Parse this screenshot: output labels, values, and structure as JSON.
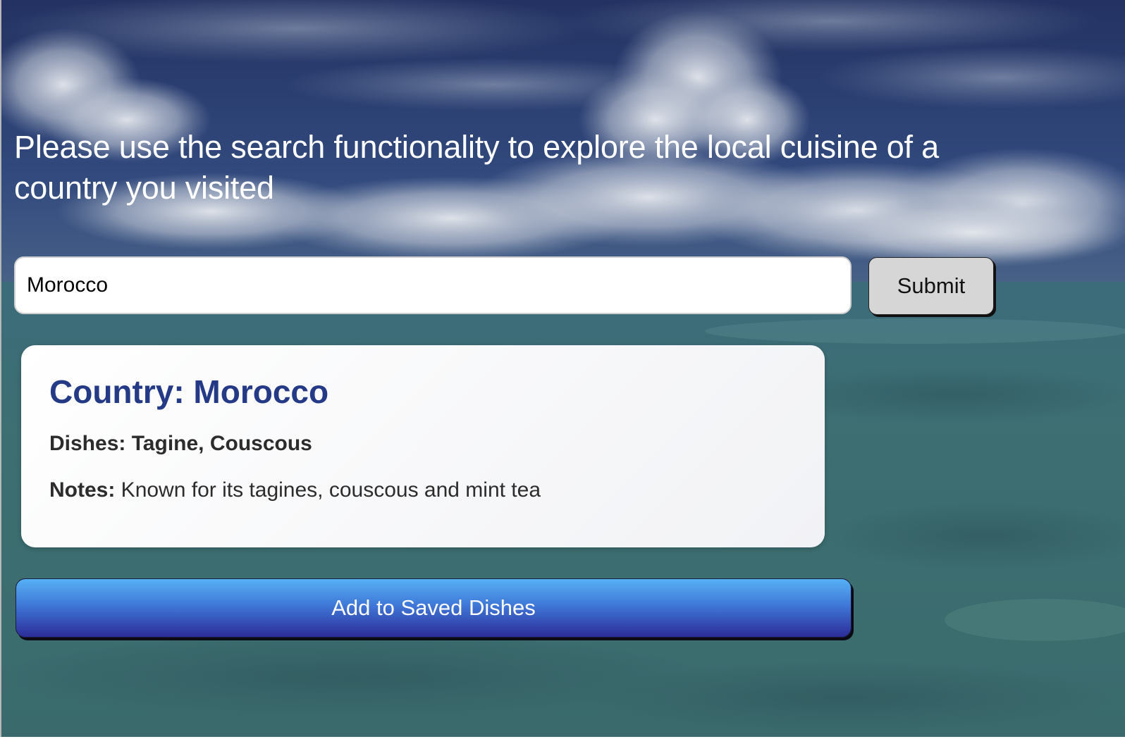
{
  "intro": {
    "text": "Please use the search functionality to explore the local cuisine of a country you visited"
  },
  "search": {
    "value": "Morocco",
    "placeholder": "",
    "submit_label": "Submit"
  },
  "result": {
    "title": "Country: Morocco",
    "dishes": "Dishes: Tagine, Couscous",
    "notes_label": "Notes:",
    "notes_text": " Known for its tagines, couscous and mint tea"
  },
  "actions": {
    "add_label": "Add to Saved Dishes"
  },
  "colors": {
    "sky": "#2c3f6e",
    "sea": "#3f6d74",
    "title_blue": "#243a86",
    "button_top": "#56b1f5",
    "button_bottom": "#2d2c98"
  }
}
